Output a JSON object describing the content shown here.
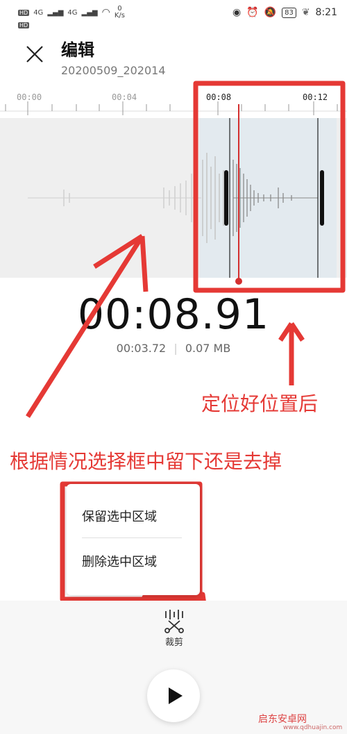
{
  "status_bar": {
    "hd1": "HD",
    "hd2": "HD",
    "net1": "4G",
    "net2": "4G",
    "speed": "0",
    "speed_unit": "K/s",
    "battery": "83",
    "time": "8:21"
  },
  "header": {
    "title": "编辑",
    "subtitle": "20200509_202014"
  },
  "timeline": {
    "labels": [
      "00:00",
      "00:04",
      "00:08",
      "00:12"
    ]
  },
  "player": {
    "current_time": "00:08.91",
    "selection_duration": "00:03.72",
    "separator": "|",
    "size": "0.07 MB"
  },
  "annotations": {
    "after_position": "定位好位置后",
    "choose": "根据情况选择框中留下还是去掉"
  },
  "menu": {
    "keep": "保留选中区域",
    "delete": "删除选中区域"
  },
  "toolbar": {
    "crop_label": "裁剪"
  },
  "watermark": {
    "brand": "启东安卓网",
    "url": "www.qdhuajin.com"
  },
  "colors": {
    "annotation": "#e53935",
    "selection_bg": "#e3eaef",
    "playhead": "#d32f2f"
  }
}
